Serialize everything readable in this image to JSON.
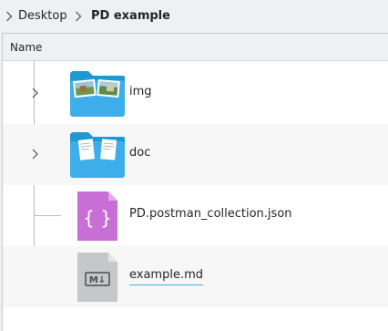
{
  "breadcrumb": {
    "items": [
      "Desktop",
      "PD example"
    ]
  },
  "header": {
    "name_column": "Name"
  },
  "files": [
    {
      "name": "img",
      "type": "folder",
      "icon": "folder-images-icon",
      "expandable": true
    },
    {
      "name": "doc",
      "type": "folder",
      "icon": "folder-documents-icon",
      "expandable": true
    },
    {
      "name": "PD.postman_collection.json",
      "type": "file",
      "icon": "json-file-icon",
      "expandable": false
    },
    {
      "name": "example.md",
      "type": "file",
      "icon": "markdown-file-icon",
      "expandable": false,
      "selected": true
    }
  ],
  "colors": {
    "folder": "#3daee9",
    "folder_dark": "#1d99d3",
    "json": "#c86fd5",
    "markdown": "#c6c7c8",
    "selection_underline": "#3daee9"
  }
}
